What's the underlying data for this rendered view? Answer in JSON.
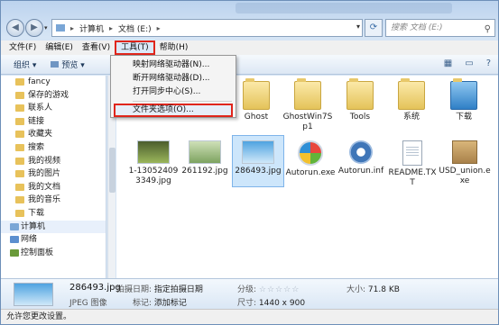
{
  "address": {
    "crumbs": [
      "计算机",
      "文档 (E:)"
    ],
    "search_placeholder": "搜索 文档 (E:)"
  },
  "menubar": {
    "items": [
      {
        "label": "文件(F)"
      },
      {
        "label": "编辑(E)"
      },
      {
        "label": "查看(V)"
      },
      {
        "label": "工具(T)"
      },
      {
        "label": "帮助(H)"
      }
    ]
  },
  "toolbar": {
    "organize": "组织 ▾",
    "preview": "预览 ▾"
  },
  "tools_menu": {
    "items": [
      {
        "label": "映射网络驱动器(N)..."
      },
      {
        "label": "断开网络驱动器(D)..."
      },
      {
        "label": "打开同步中心(S)..."
      },
      {
        "label": "文件夹选项(O)..."
      }
    ]
  },
  "nav": {
    "items": [
      {
        "label": "fancy"
      },
      {
        "label": "保存的游戏"
      },
      {
        "label": "联系人"
      },
      {
        "label": "链接"
      },
      {
        "label": "收藏夹"
      },
      {
        "label": "搜索"
      },
      {
        "label": "我的视频"
      },
      {
        "label": "我的图片"
      },
      {
        "label": "我的文档"
      },
      {
        "label": "我的音乐"
      },
      {
        "label": "下载"
      },
      {
        "label": "计算机"
      },
      {
        "label": "网络"
      },
      {
        "label": "控制面板"
      }
    ]
  },
  "files": {
    "row1": [
      {
        "name": "Ghost"
      },
      {
        "name": "GhostWin7Sp1"
      },
      {
        "name": "Tools"
      },
      {
        "name": "系统"
      },
      {
        "name": "下载"
      }
    ],
    "row2": [
      {
        "name": "1-130524093349.jpg"
      },
      {
        "name": "261192.jpg"
      },
      {
        "name": "286493.jpg"
      },
      {
        "name": "Autorun.exe"
      },
      {
        "name": "Autorun.inf"
      },
      {
        "name": "README.TXT"
      },
      {
        "name": "USD_union.exe"
      }
    ]
  },
  "details": {
    "name": "286493.jpg",
    "type": "JPEG 图像",
    "date_label": "拍摄日期:",
    "date_value": "指定拍摄日期",
    "tags_label": "标记:",
    "tags_value": "添加标记",
    "rating_label": "分级:",
    "rating_stars": "☆☆☆☆☆",
    "size_label": "大小:",
    "size_value": "71.8 KB",
    "dims_label": "尺寸:",
    "dims_value": "1440 x 900"
  },
  "status": {
    "text": "允许您更改设置。"
  }
}
